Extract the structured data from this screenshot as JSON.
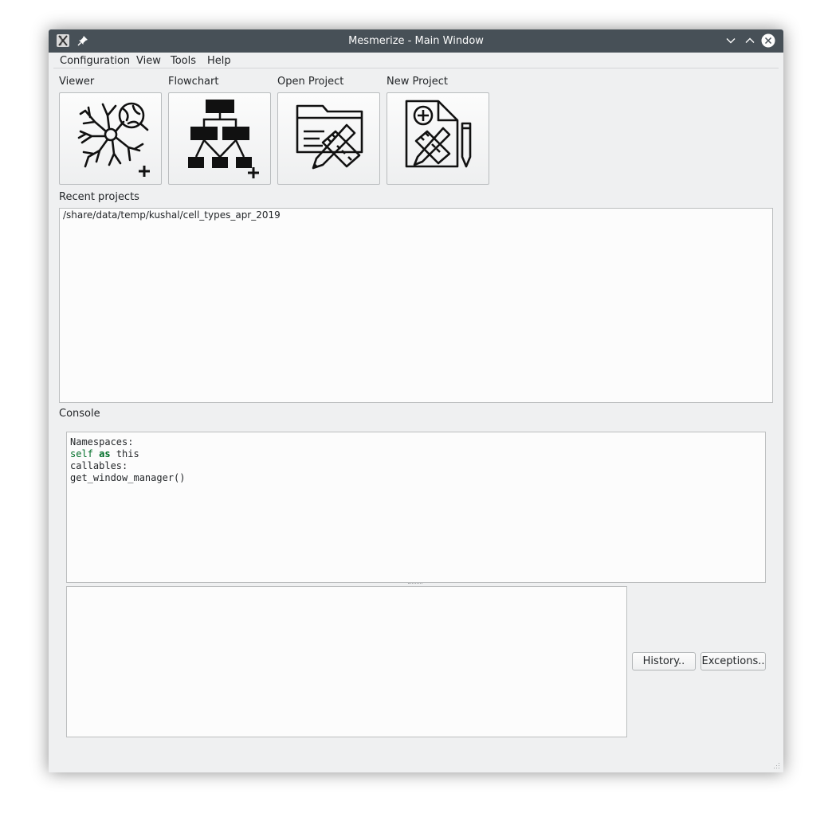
{
  "window": {
    "title": "Mesmerize - Main Window"
  },
  "menubar": {
    "items": [
      {
        "label": "Configuration"
      },
      {
        "label": "View"
      },
      {
        "label": "Tools"
      },
      {
        "label": "Help"
      }
    ]
  },
  "toolbar": {
    "viewer_label": "Viewer",
    "flowchart_label": "Flowchart",
    "open_project_label": "Open Project",
    "new_project_label": "New Project"
  },
  "recent_projects": {
    "label": "Recent projects",
    "items": [
      "/share/data/temp/kushal/cell_types_apr_2019"
    ]
  },
  "console": {
    "label": "Console",
    "line1": "Namespaces:",
    "line2_a": "self",
    "line2_b": "as",
    "line2_c": "this",
    "line3": "callables:",
    "line4": "get_window_manager()",
    "history_label": "History..",
    "exceptions_label": "Exceptions.."
  },
  "colors": {
    "titlebar": "#475057",
    "window_bg": "#eff0f1",
    "syntax_green": "#006e28"
  }
}
